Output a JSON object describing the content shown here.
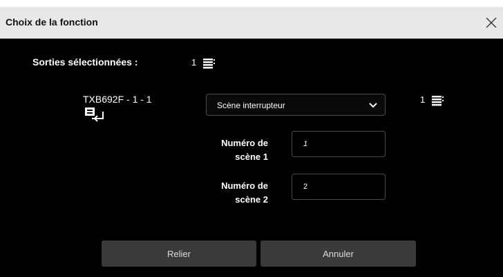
{
  "dialog": {
    "title": "Choix de la fonction",
    "close_icon": "close-icon"
  },
  "selection": {
    "label": "Sorties sélectionnées :",
    "count": "1",
    "icon": "outputs-stack-icon"
  },
  "device": {
    "name": "TXB692F - 1 - 1",
    "icon": "device-link-icon",
    "count": "1"
  },
  "function_select": {
    "value": "Scène interrupteur",
    "icon": "chevron-down-icon"
  },
  "fields": [
    {
      "label": "Numéro de scène 1",
      "value": "1"
    },
    {
      "label": "Numéro de scène 2",
      "value": "2"
    }
  ],
  "buttons": {
    "link": "Relier",
    "cancel": "Annuler"
  },
  "colors": {
    "background": "#000000",
    "titlebar": "#e8e8e8",
    "button": "#3a3a3a",
    "border": "#4a4a4a"
  }
}
